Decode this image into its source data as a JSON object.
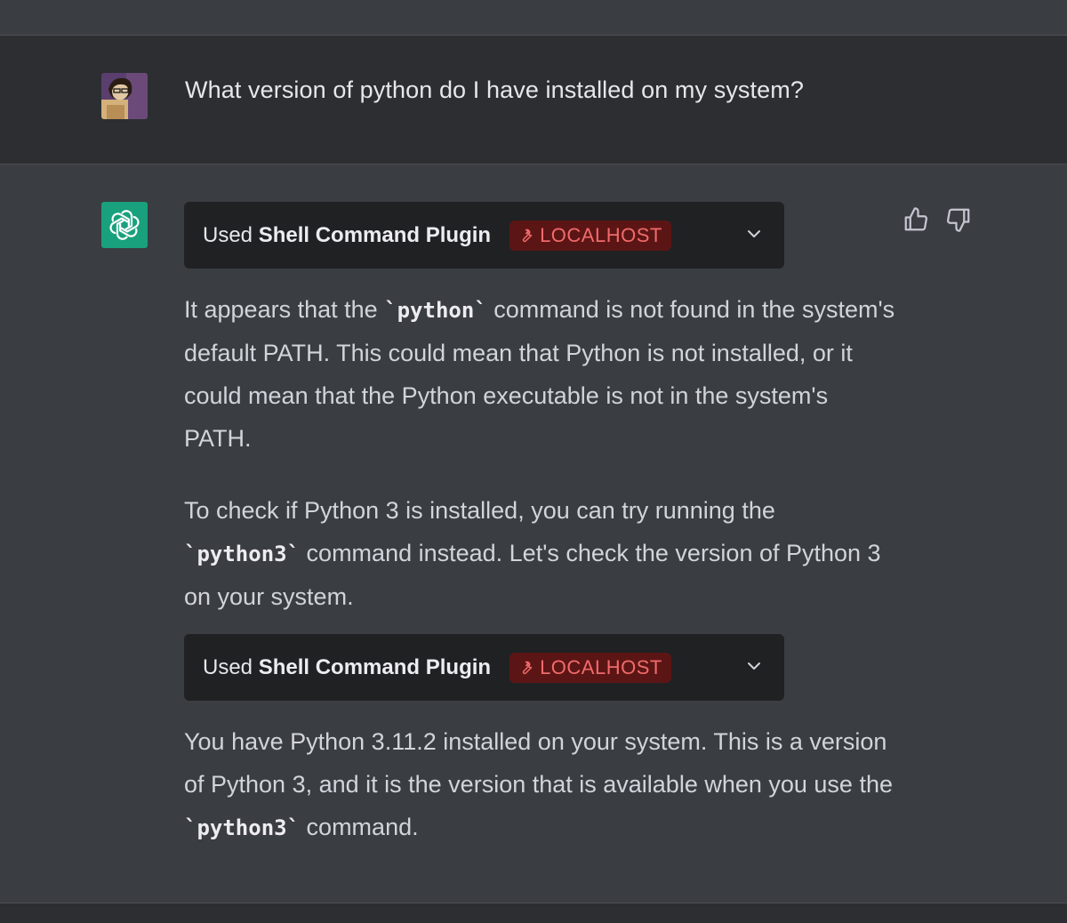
{
  "user_message": {
    "text": "What version of python do I have installed on my system?"
  },
  "plugin_calls": [
    {
      "used_label": "Used",
      "plugin_name": "Shell Command Plugin",
      "badge": "LOCALHOST"
    },
    {
      "used_label": "Used",
      "plugin_name": "Shell Command Plugin",
      "badge": "LOCALHOST"
    }
  ],
  "response": {
    "p1": {
      "before": "It appears that the ",
      "code": "`python`",
      "after": " command is not found in the system's default PATH. This could mean that Python is not installed, or it could mean that the Python executable is not in the system's PATH."
    },
    "p2": {
      "before": "To check if Python 3 is installed, you can try running the ",
      "code": "`python3`",
      "after": " command instead. Let's check the version of Python 3 on your system."
    },
    "p3": {
      "before": "You have Python 3.11.2 installed on your system. This is a version of Python 3, and it is the version that is available when you use the ",
      "code": "`python3`",
      "after": " command."
    }
  },
  "icons": {
    "thumbs_up": "thumbs-up-icon",
    "thumbs_down": "thumbs-down-icon",
    "chevron": "chevron-down-icon",
    "wrench": "wrench-icon"
  },
  "colors": {
    "badge_bg": "#5c1515",
    "badge_text": "#f06b6b",
    "assistant_avatar": "#19a07c"
  }
}
